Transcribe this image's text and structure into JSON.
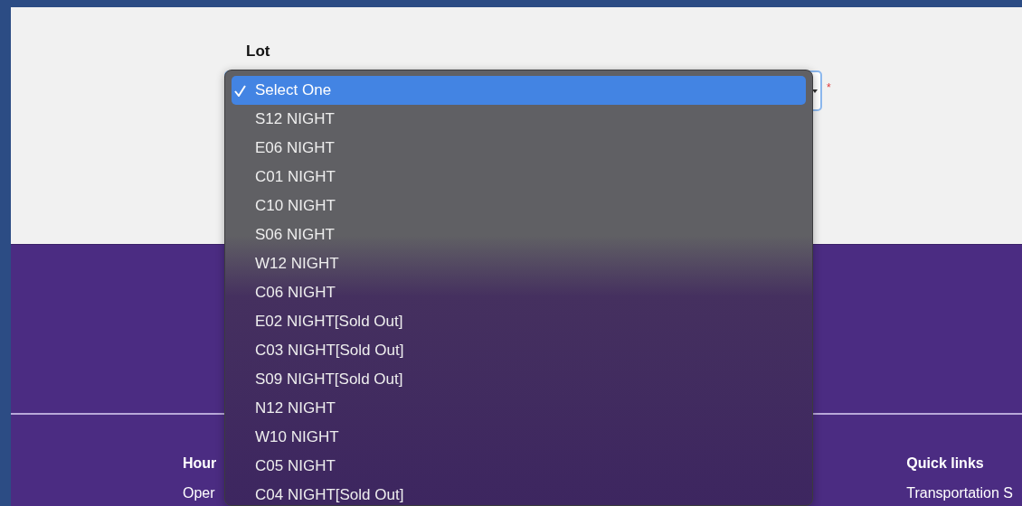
{
  "form": {
    "label": "Lot",
    "required_mark": "*"
  },
  "lot_menu": {
    "items": [
      {
        "label": "Select One",
        "selected": true
      },
      {
        "label": "S12 NIGHT",
        "selected": false
      },
      {
        "label": "E06 NIGHT",
        "selected": false
      },
      {
        "label": "C01 NIGHT",
        "selected": false
      },
      {
        "label": "C10 NIGHT",
        "selected": false
      },
      {
        "label": "S06 NIGHT",
        "selected": false
      },
      {
        "label": "W12 NIGHT",
        "selected": false
      },
      {
        "label": "C06 NIGHT",
        "selected": false
      },
      {
        "label": "E02 NIGHT[Sold Out]",
        "selected": false
      },
      {
        "label": "C03 NIGHT[Sold Out]",
        "selected": false
      },
      {
        "label": "S09 NIGHT[Sold Out]",
        "selected": false
      },
      {
        "label": "N12 NIGHT",
        "selected": false
      },
      {
        "label": "W10 NIGHT",
        "selected": false
      },
      {
        "label": "C05 NIGHT",
        "selected": false
      },
      {
        "label": "C04 NIGHT[Sold Out]",
        "selected": false
      }
    ]
  },
  "footer": {
    "columns": [
      {
        "heading": "Hour",
        "lines": [
          "Oper"
        ]
      },
      {
        "heading": "Quick links",
        "lines": [
          "Transportation S"
        ]
      }
    ]
  }
}
